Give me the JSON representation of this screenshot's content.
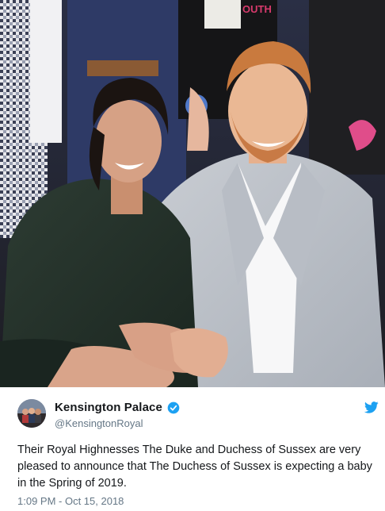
{
  "tweet": {
    "display_name": "Kensington Palace",
    "handle": "@KensingtonRoyal",
    "text": "Their Royal Highnesses The Duke and Duchess of Sussex are very pleased to announce that The Duchess of Sussex is expecting a baby in the Spring of 2019.",
    "timestamp": "1:09 PM - Oct 15, 2018",
    "verified": true
  },
  "photo": {
    "badge_text": "OUTH"
  },
  "icons": {
    "verified": "verified-badge-icon",
    "brand": "twitter-bird-icon"
  },
  "colors": {
    "twitter_blue": "#1da1f2",
    "text_primary": "#14171a",
    "text_secondary": "#657786"
  }
}
